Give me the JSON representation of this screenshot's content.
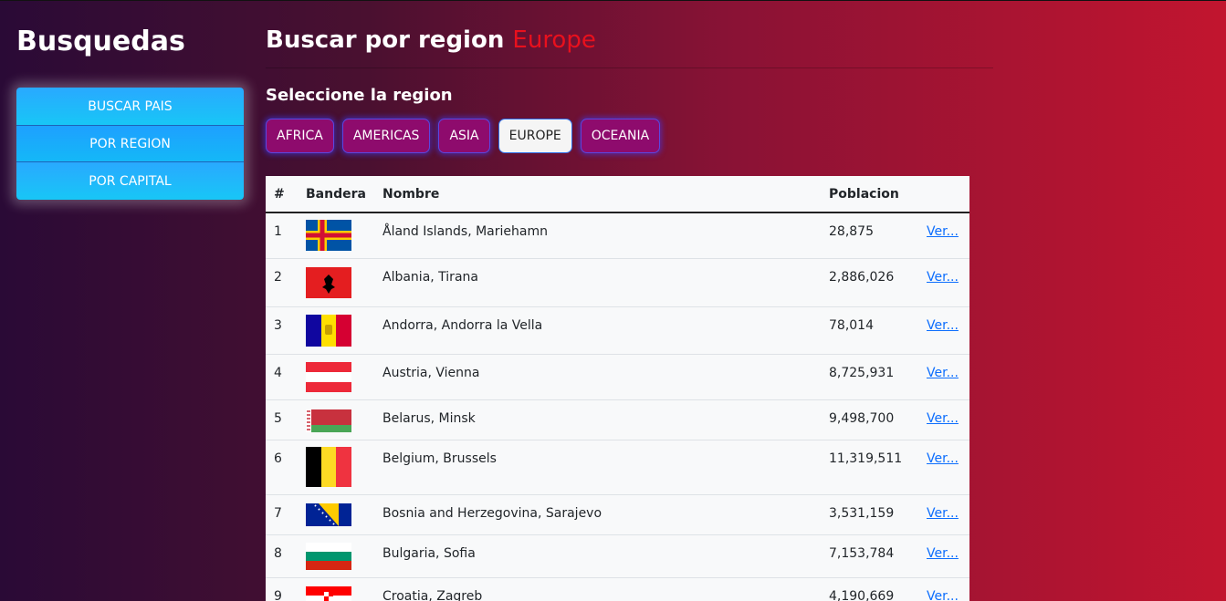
{
  "sidebar": {
    "title": "Busquedas",
    "items": [
      {
        "label": "BUSCAR PAIS",
        "active": false
      },
      {
        "label": "POR REGION",
        "active": true
      },
      {
        "label": "POR CAPITAL",
        "active": false
      }
    ]
  },
  "main": {
    "title": "Buscar por region",
    "selected_region": "Europe",
    "subtitle": "Seleccione la region",
    "regions": [
      "AFRICA",
      "AMERICAS",
      "ASIA",
      "EUROPE",
      "OCEANIA"
    ],
    "active_region": "EUROPE"
  },
  "table": {
    "headers": [
      "#",
      "Bandera",
      "Nombre",
      "Poblacion",
      ""
    ],
    "link_label": "Ver...",
    "rows": [
      {
        "num": "1",
        "flag": "aland-flag-icon",
        "name": "Åland Islands, Mariehamn",
        "population": "28,875",
        "link": "Ver..."
      },
      {
        "num": "2",
        "flag": "albania-flag-icon",
        "name": "Albania, Tirana",
        "population": "2,886,026",
        "link": "Ver..."
      },
      {
        "num": "3",
        "flag": "andorra-flag-icon",
        "name": "Andorra, Andorra la Vella",
        "population": "78,014",
        "link": "Ver..."
      },
      {
        "num": "4",
        "flag": "austria-flag-icon",
        "name": "Austria, Vienna",
        "population": "8,725,931",
        "link": "Ver..."
      },
      {
        "num": "5",
        "flag": "belarus-flag-icon",
        "name": "Belarus, Minsk",
        "population": "9,498,700",
        "link": "Ver..."
      },
      {
        "num": "6",
        "flag": "belgium-flag-icon",
        "name": "Belgium, Brussels",
        "population": "11,319,511",
        "link": "Ver..."
      },
      {
        "num": "7",
        "flag": "bosnia-flag-icon",
        "name": "Bosnia and Herzegovina, Sarajevo",
        "population": "3,531,159",
        "link": "Ver..."
      },
      {
        "num": "8",
        "flag": "bulgaria-flag-icon",
        "name": "Bulgaria, Sofia",
        "population": "7,153,784",
        "link": "Ver..."
      },
      {
        "num": "9",
        "flag": "croatia-flag-icon",
        "name": "Croatia, Zagreb",
        "population": "4,190,669",
        "link": "Ver..."
      }
    ]
  },
  "colors": {
    "accent_region": "#e8101d",
    "menu_blue": "#1ea0ff",
    "region_button": "#8e0b6d",
    "link": "#0d6efd"
  }
}
